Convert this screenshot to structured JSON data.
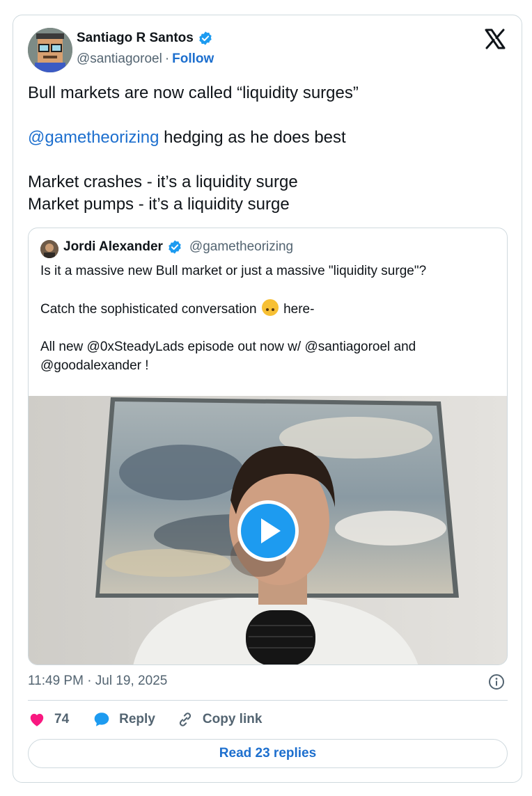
{
  "author": {
    "name": "Santiago R Santos",
    "handle": "@santiagoroel",
    "separator": "·",
    "follow_label": "Follow"
  },
  "tweet": {
    "line1": "Bull markets are now called “liquidity surges”",
    "mention": "@gametheorizing",
    "line2_rest": " hedging as he does best",
    "line3": "Market crashes - it’s a liquidity surge",
    "line4": "Market pumps - it’s a liquidity surge"
  },
  "quote": {
    "name": "Jordi Alexander",
    "handle": "@gametheorizing",
    "line1": "Is it a massive new Bull market or just a massive \"liquidity surge\"?",
    "line2_before": "Catch the sophisticated conversation ",
    "line2_after": " here-",
    "line3": "All new @0xSteadyLads episode out now w/ @santiagoroel and",
    "line4": "@goodalexander !"
  },
  "meta": {
    "timestamp": "11:49 PM · Jul 19, 2025"
  },
  "actions": {
    "like_count": "74",
    "reply_label": "Reply",
    "copy_label": "Copy link"
  },
  "footer": {
    "read_replies_label": "Read 23 replies"
  },
  "colors": {
    "link": "#1d6fce",
    "heart": "#f91880",
    "verified": "#1d9bf0",
    "play": "#1d9bf0"
  },
  "icons": [
    "verified-badge-icon",
    "x-logo-icon",
    "heart-icon",
    "reply-bubble-icon",
    "link-icon",
    "info-icon",
    "play-icon",
    "emoji-upside-down-face"
  ]
}
